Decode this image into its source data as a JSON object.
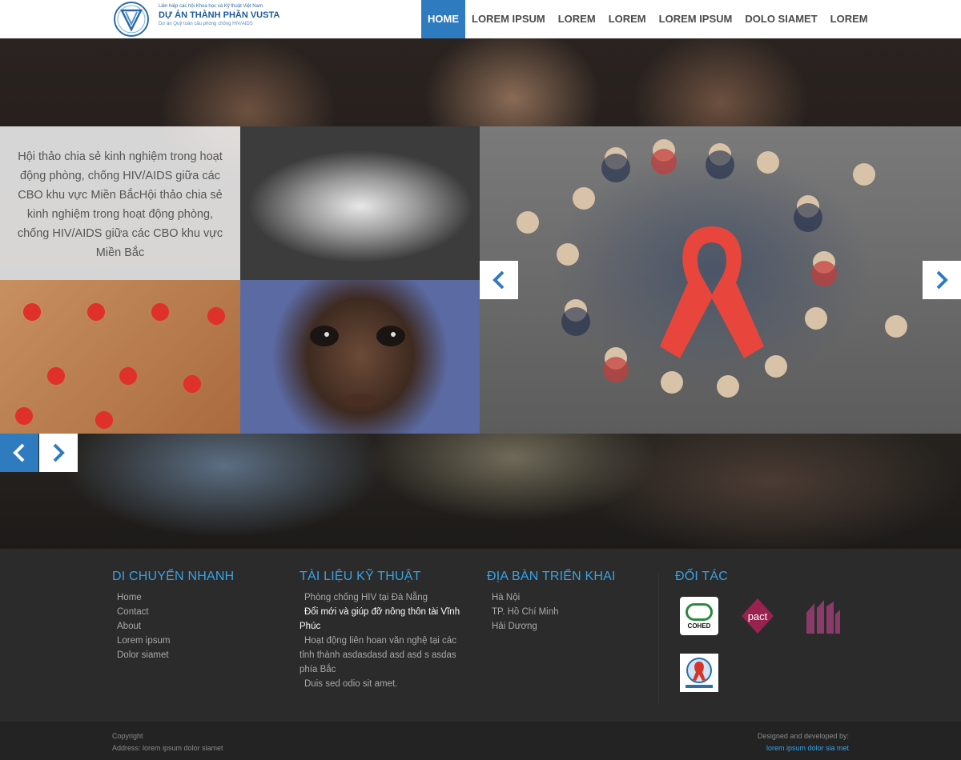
{
  "header": {
    "logo": {
      "line1": "Liên hiệp các hội Khoa học và Kỹ thuật Việt Nam",
      "line2": "DỰ ÁN THÀNH PHẦN VUSTA",
      "line3": "Dự án Quỹ toàn cầu phòng chống HIV/AIDS"
    },
    "nav": [
      "HOME",
      "LOREM IPSUM",
      "LOREM",
      "LOREM",
      "LOREM IPSUM",
      "DOLO SIAMET",
      "LOREM"
    ],
    "active_nav": "HOME",
    "accent_color": "#2f7bbf"
  },
  "hero": {
    "caption": "Hội thảo chia sẻ kinh nghiệm trong hoạt động phòng, chống HIV/AIDS giữa các CBO khu vực Miền BắcHội thảo chia sẻ kinh nghiệm trong hoạt động phòng, chống HIV/AIDS giữa các CBO khu vực Miền Bắc",
    "icons": {
      "prev": "chevron-left-icon",
      "next": "chevron-right-icon"
    }
  },
  "footer": {
    "col1": {
      "title": "DI CHUYỂN NHANH",
      "items": [
        "Home",
        "Contact",
        "About",
        "Lorem ipsum",
        "Dolor siamet"
      ]
    },
    "col2": {
      "title": "TÀI LIỆU KỸ THUẬT",
      "item1": "Phòng chống HIV tại Đà Nẵng",
      "item2": "Đổi mới và giúp đỡ nông thôn tài Vĩnh Phúc",
      "item3": "Hoạt động liên hoan văn nghệ tại các tỉnh thành asdasdasd asd asd s asdas phía Bắc",
      "item4": "Duis sed odio sit amet."
    },
    "col3": {
      "title": "ĐỊA BÀN TRIỂN KHAI",
      "items": [
        "Hà Nội",
        "TP. Hồ Chí Minh",
        "Hải Dương"
      ]
    },
    "col4": {
      "title": "ĐỐI TÁC",
      "partners": [
        "COHED",
        "pact",
        "ISDS"
      ]
    },
    "heading_color": "#38a3e6"
  },
  "bottom": {
    "copyright": "Copyright",
    "address": "Address: lorem ipsum dolor siamet",
    "designed": "Designed and developed by:",
    "developer": "lorem ipsum dolor sia met"
  }
}
